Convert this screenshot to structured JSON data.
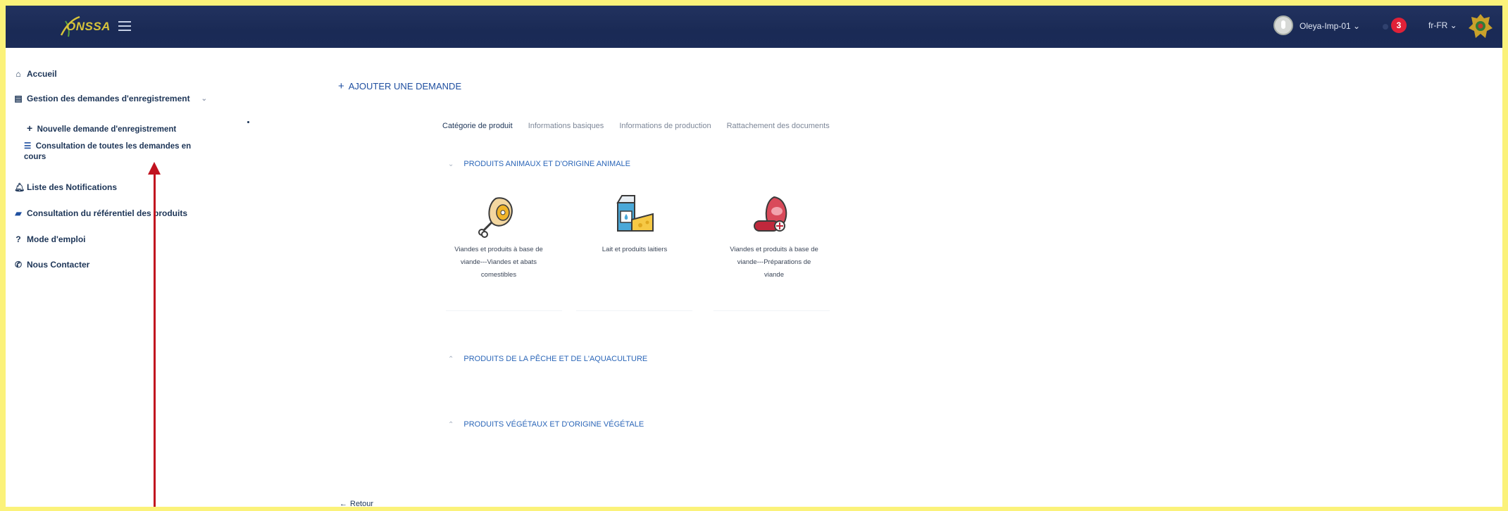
{
  "header": {
    "logo_text": "ONSSA",
    "user_name": "Oleya-Imp-01",
    "notification_count": "3",
    "language": "fr-FR"
  },
  "sidebar": {
    "items": [
      {
        "label": "Accueil",
        "icon": "home-icon"
      },
      {
        "label": "Gestion des demandes d'enregistrement",
        "icon": "document-icon"
      },
      {
        "label": "Nouvelle demande d'enregistrement",
        "icon": "plus-icon"
      },
      {
        "label": "Consultation de toutes les demandes en",
        "label_line2": "cours",
        "icon": "list-icon"
      },
      {
        "label": "Liste des Notifications",
        "icon": "bell-icon"
      },
      {
        "label": "Consultation du référentiel des produits",
        "icon": "book-icon"
      },
      {
        "label": "Mode d'emploi",
        "icon": "question-icon"
      },
      {
        "label": "Nous Contacter",
        "icon": "phone-icon"
      }
    ]
  },
  "main": {
    "add_request_label": "AJOUTER UNE DEMANDE",
    "tabs": [
      {
        "label": "Catégorie de produit",
        "active": true
      },
      {
        "label": "Informations basiques",
        "active": false
      },
      {
        "label": "Informations de production",
        "active": false
      },
      {
        "label": "Rattachement des documents",
        "active": false
      }
    ],
    "sections": [
      {
        "title": "PRODUITS ANIMAUX ET D'ORIGINE ANIMALE",
        "expanded": true
      },
      {
        "title": "PRODUITS DE LA PÊCHE ET DE L'AQUACULTURE",
        "expanded": false
      },
      {
        "title": "PRODUITS VÉGÉTAUX ET D'ORIGINE VÉGÉTALE",
        "expanded": false
      }
    ],
    "products": [
      {
        "line1": "Viandes et produits à base de",
        "line2": "viande---Viandes et abats",
        "line3": "comestibles",
        "icon": "meat-icon"
      },
      {
        "line1": "Lait et produits laitiers",
        "line2": "",
        "line3": "",
        "icon": "dairy-icon"
      },
      {
        "line1": "Viandes et produits à base de",
        "line2": "viande---Préparations de",
        "line3": "viande",
        "icon": "sausage-icon"
      }
    ],
    "back_label": "Retour"
  },
  "colors": {
    "frame": "#fbf27a",
    "navbar": "#1a2a55",
    "accent": "#2b66b8",
    "badge": "#e02138",
    "annotation_arrow": "#c1121f"
  }
}
